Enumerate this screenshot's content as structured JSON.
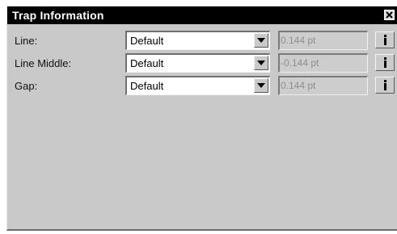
{
  "window": {
    "title": "Trap Information"
  },
  "icons": {
    "close": "close-icon",
    "dropdown": "triangle-down-icon",
    "info": "info-icon"
  },
  "rows": [
    {
      "label": "Line:",
      "dropdown_value": "Default",
      "field_value": "0.144 pt"
    },
    {
      "label": "Line Middle:",
      "dropdown_value": "Default",
      "field_value": "-0.144 pt"
    },
    {
      "label": "Gap:",
      "dropdown_value": "Default",
      "field_value": "0.144 pt"
    }
  ],
  "colors": {
    "titlebar": "#000000",
    "panel": "#c9c9c9"
  }
}
